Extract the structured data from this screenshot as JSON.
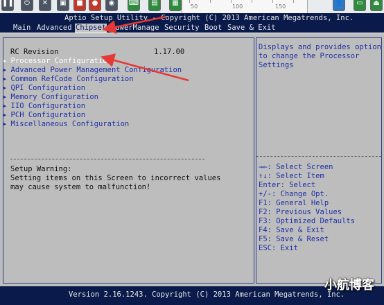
{
  "toolbar": {
    "ruler_ticks": [
      "50",
      "100",
      "150"
    ]
  },
  "header": {
    "title": "Aptio Setup Utility - Copyright (C) 2013 American Megatrends, Inc.",
    "menu": [
      "Main",
      "Advanced",
      "Chipset",
      "PowerManage",
      "Security",
      "Boot",
      "Save & Exit"
    ],
    "active_menu": "Chipset"
  },
  "main": {
    "rc_revision_label": "RC Revision",
    "rc_revision_value": "1.17.00",
    "items": [
      "Processor Configuration",
      "Advanced Power Management Configuration",
      "Common RefCode Configuration",
      "QPI Configuration",
      "Memory Configuration",
      "IIO Configuration",
      "PCH Configuration",
      "Miscellaneous Configuration"
    ],
    "selected_item": 0,
    "warning_title": "Setup Warning:",
    "warning_lines": [
      "Setting items on this Screen to incorrect values",
      "may cause system to malfunction!"
    ]
  },
  "help": {
    "description_lines": [
      "Displays and provides option",
      "to change the Processor",
      "Settings"
    ],
    "keys": [
      "→←: Select Screen",
      "↑↓: Select Item",
      "Enter: Select",
      "+/-: Change Opt.",
      "F1: General Help",
      "F2: Previous Values",
      "F3: Optimized Defaults",
      "F4: Save & Exit",
      "F5: Save & Reset",
      "ESC: Exit"
    ]
  },
  "footer": {
    "version": "Version 2.16.1243. Copyright (C) 2013 American Megatrends, Inc."
  },
  "watermark": "小航博客",
  "colors": {
    "bios_blue": "#0a1a4a",
    "panel_gray": "#bdbdbd",
    "text_blue": "#1d2fa8",
    "arrow_red": "#e53935"
  }
}
